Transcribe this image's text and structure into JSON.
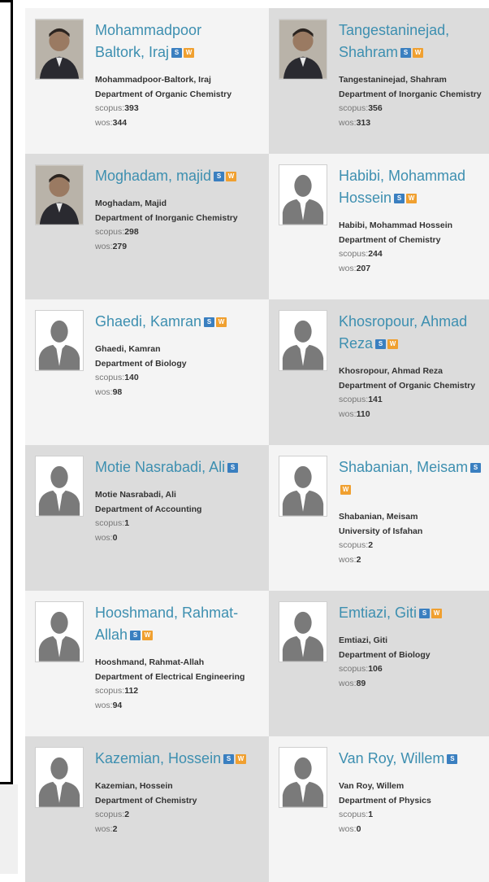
{
  "badges": {
    "s": "S",
    "w": "W"
  },
  "stat_labels": {
    "scopus": "scopus:",
    "wos": "wos:"
  },
  "people": [
    {
      "name_line1": "Mohammadpoor",
      "name_line2": "Baltork, Iraj",
      "full_name": "Mohammadpoor-Baltork, Iraj",
      "department": "Department of Organic Chemistry",
      "scopus": "393",
      "wos": "344",
      "has_s": true,
      "has_w": true,
      "photo": "photo"
    },
    {
      "name_line1": "Tangestaninejad,",
      "name_line2": "Shahram",
      "full_name": "Tangestaninejad, Shahram",
      "department": "Department of Inorganic Chemistry",
      "scopus": "356",
      "wos": "313",
      "has_s": true,
      "has_w": true,
      "photo": "photo"
    },
    {
      "name_line1": "Moghadam, majid",
      "name_line2": "",
      "full_name": "Moghadam, Majid",
      "department": "Department of Inorganic Chemistry",
      "scopus": "298",
      "wos": "279",
      "has_s": true,
      "has_w": true,
      "photo": "photo"
    },
    {
      "name_line1": "Habibi, Mohammad",
      "name_line2": "Hossein",
      "full_name": "Habibi, Mohammad Hossein",
      "department": "Department of Chemistry",
      "scopus": "244",
      "wos": "207",
      "has_s": true,
      "has_w": true,
      "photo": "placeholder"
    },
    {
      "name_line1": "Ghaedi, Kamran",
      "name_line2": "",
      "full_name": "Ghaedi, Kamran",
      "department": "Department of Biology",
      "scopus": "140",
      "wos": "98",
      "has_s": true,
      "has_w": true,
      "photo": "placeholder"
    },
    {
      "name_line1": "Khosropour, Ahmad",
      "name_line2": "Reza",
      "full_name": "Khosropour, Ahmad Reza",
      "department": "Department of Organic Chemistry",
      "scopus": "141",
      "wos": "110",
      "has_s": true,
      "has_w": true,
      "photo": "placeholder"
    },
    {
      "name_line1": "Motie Nasrabadi, Ali",
      "name_line2": "",
      "full_name": "Motie Nasrabadi, Ali",
      "department": "Department of Accounting",
      "scopus": "1",
      "wos": "0",
      "has_s": true,
      "has_w": false,
      "photo": "placeholder"
    },
    {
      "name_line1": "Shabanian, Meisam",
      "name_line2": "",
      "full_name": "Shabanian, Meisam",
      "department": "University of Isfahan",
      "scopus": "2",
      "wos": "2",
      "has_s": true,
      "has_w": true,
      "photo": "placeholder"
    },
    {
      "name_line1": "Hooshmand, Rahmat-",
      "name_line2": "Allah",
      "full_name": "Hooshmand, Rahmat-Allah",
      "department": "Department of Electrical Engineering",
      "scopus": "112",
      "wos": "94",
      "has_s": true,
      "has_w": true,
      "photo": "placeholder"
    },
    {
      "name_line1": "Emtiazi, Giti",
      "name_line2": "",
      "full_name": "Emtiazi, Giti",
      "department": "Department of Biology",
      "scopus": "106",
      "wos": "89",
      "has_s": true,
      "has_w": true,
      "photo": "placeholder"
    },
    {
      "name_line1": "Kazemian, Hossein",
      "name_line2": "",
      "full_name": "Kazemian, Hossein",
      "department": "Department of Chemistry",
      "scopus": "2",
      "wos": "2",
      "has_s": true,
      "has_w": true,
      "photo": "placeholder"
    },
    {
      "name_line1": "Van Roy, Willem",
      "name_line2": "",
      "full_name": "Van Roy, Willem",
      "department": "Department of Physics",
      "scopus": "1",
      "wos": "0",
      "has_s": true,
      "has_w": false,
      "photo": "placeholder"
    }
  ]
}
